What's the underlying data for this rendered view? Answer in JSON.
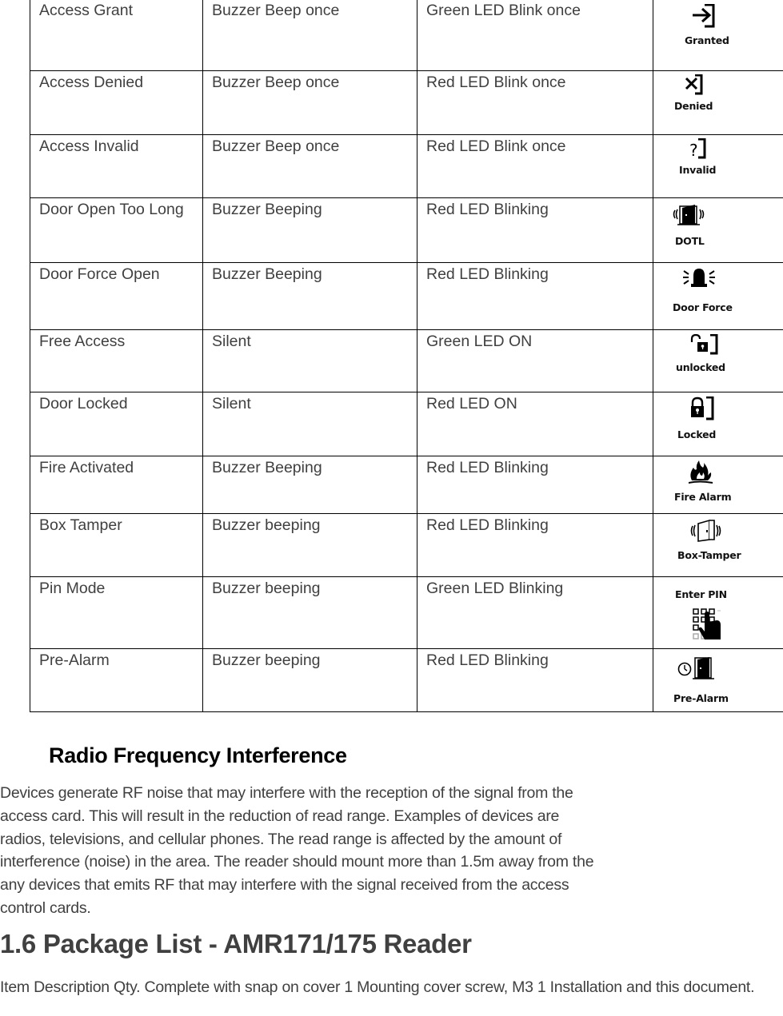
{
  "status_table": {
    "rows": [
      {
        "event": "Access Grant",
        "buzzer": "Buzzer Beep once",
        "led": "Green LED Blink once",
        "icon": "granted-icon",
        "icon_label": "Granted"
      },
      {
        "event": "Access Denied",
        "buzzer": "Buzzer Beep once",
        "led": "Red LED Blink once",
        "icon": "denied-icon",
        "icon_label": "Denied"
      },
      {
        "event": "Access Invalid",
        "buzzer": "Buzzer Beep once",
        "led": "Red LED Blink once",
        "icon": "invalid-icon",
        "icon_label": "Invalid"
      },
      {
        "event": "Door Open Too Long",
        "buzzer": "Buzzer Beeping",
        "led": "Red LED Blinking",
        "icon": "door-open-too-long-icon",
        "icon_label": "DOTL"
      },
      {
        "event": "Door Force Open",
        "buzzer": "Buzzer Beeping",
        "led": "Red LED Blinking",
        "icon": "alarm-beacon-icon",
        "icon_label": "Door Force"
      },
      {
        "event": "Free Access",
        "buzzer": "Silent",
        "led": "Green LED ON",
        "icon": "unlocked-icon",
        "icon_label": "unlocked"
      },
      {
        "event": "Door Locked",
        "buzzer": "Silent",
        "led": "Red LED ON",
        "icon": "locked-icon",
        "icon_label": "Locked"
      },
      {
        "event": "Fire Activated",
        "buzzer": "Buzzer Beeping",
        "led": "Red LED Blinking",
        "icon": "fire-icon",
        "icon_label": "Fire Alarm"
      },
      {
        "event": "Box Tamper",
        "buzzer": "Buzzer beeping",
        "led": "Red LED Blinking",
        "icon": "box-tamper-icon",
        "icon_label": "Box-Tamper"
      },
      {
        "event": "Pin Mode",
        "buzzer": "Buzzer beeping",
        "led": "Green LED Blinking",
        "icon": "keypad-hand-icon",
        "icon_label": "Enter PIN"
      },
      {
        "event": "Pre-Alarm",
        "buzzer": "Buzzer beeping",
        "led": "Red LED Blinking",
        "icon": "clock-door-icon",
        "icon_label": "Pre-Alarm"
      }
    ]
  },
  "rf_section": {
    "heading": "Radio Frequency Interference",
    "body": "Devices generate RF noise that may interfere with the reception of the signal from the access card. This will result in the reduction of read range. Examples of devices are radios, televisions, and cellular phones. The read range is affected by the amount of interference (noise) in the area. The reader should mount more than 1.5m away from the any devices that emits RF that may interfere with the signal received from the access control cards."
  },
  "package_section": {
    "heading": "1.6 Package List - AMR171/175 Reader",
    "body": "Item Description Qty. Complete with snap on cover 1 Mounting cover screw, M3 1 Installation and this document."
  }
}
